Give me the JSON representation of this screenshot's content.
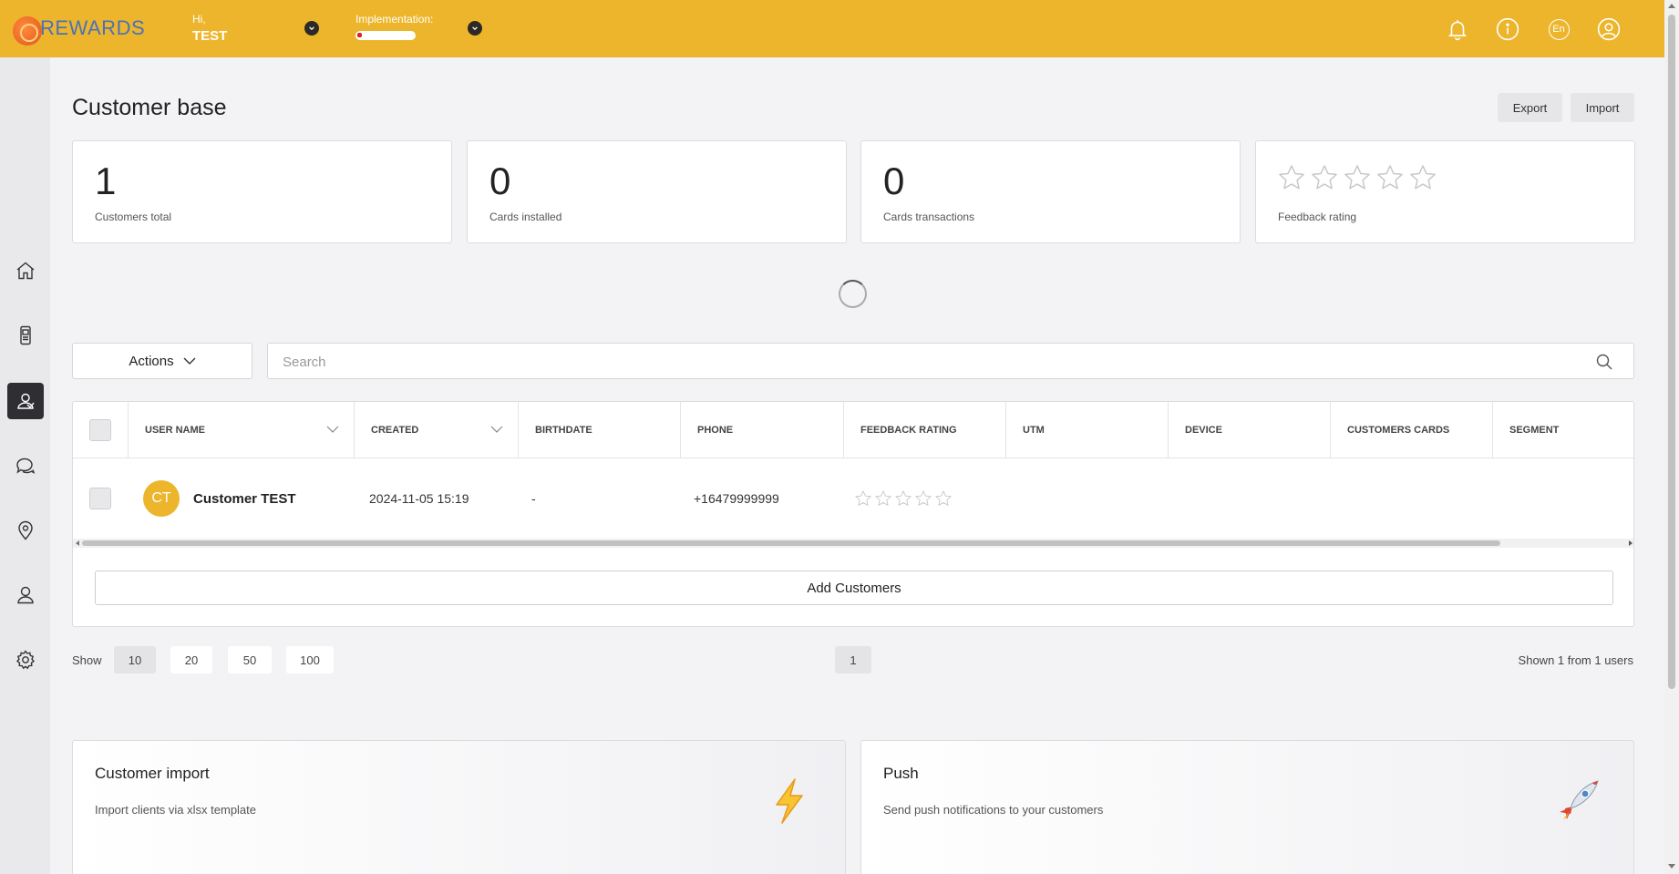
{
  "header": {
    "logo_small": "CLIENT ENGAGE",
    "logo_text": "REWARDS",
    "greeting": "Hi,",
    "user_name": "TEST",
    "implementation_label": "Implementation:",
    "implementation_progress": 0.08,
    "language": "En"
  },
  "page": {
    "title": "Customer base",
    "export_label": "Export",
    "import_label": "Import"
  },
  "stats": [
    {
      "value": "1",
      "label": "Customers total"
    },
    {
      "value": "0",
      "label": "Cards installed"
    },
    {
      "value": "0",
      "label": "Cards transactions"
    },
    {
      "label": "Feedback rating",
      "rating": 0,
      "max": 5
    }
  ],
  "toolbar": {
    "actions_label": "Actions",
    "search_placeholder": "Search"
  },
  "table": {
    "columns": [
      "USER NAME",
      "CREATED",
      "BIRTHDATE",
      "PHONE",
      "FEEDBACK RATING",
      "UTM",
      "DEVICE",
      "CUSTOMERS CARDS",
      "SEGMENT"
    ],
    "rows": [
      {
        "initials": "CT",
        "name": "Customer TEST",
        "created": "2024-11-05 15:19",
        "birthdate": "-",
        "phone": "+16479999999",
        "rating": 0
      }
    ],
    "add_label": "Add Customers"
  },
  "pagination": {
    "show_label": "Show",
    "sizes": [
      "10",
      "20",
      "50",
      "100"
    ],
    "selected_size": "10",
    "current_page": "1",
    "summary": "Shown 1 from 1 users"
  },
  "promos": [
    {
      "title": "Customer import",
      "desc": "Import clients via xlsx template",
      "icon": "lightning-icon"
    },
    {
      "title": "Push",
      "desc": "Send push notifications to your customers",
      "icon": "rocket-icon"
    }
  ],
  "colors": {
    "brand": "#ecb52b",
    "sidebar_active": "#2f2f33",
    "progress": "#d42424"
  }
}
